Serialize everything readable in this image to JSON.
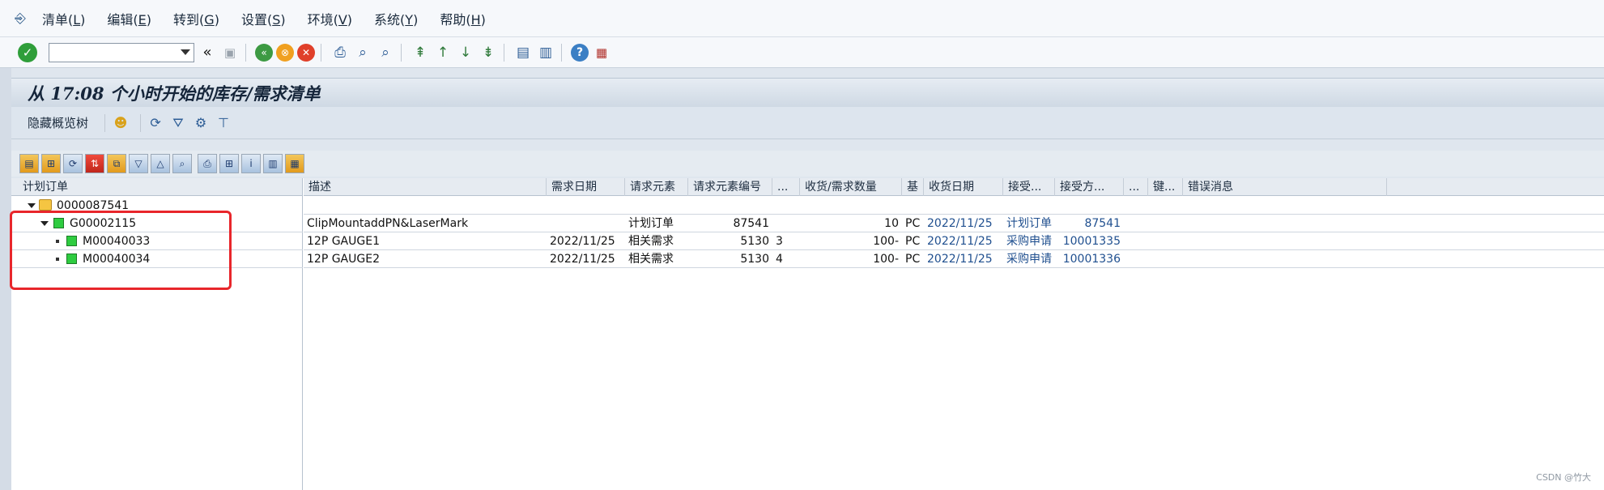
{
  "menu": {
    "items": [
      {
        "label": "清单(",
        "key": "L",
        "tail": ")"
      },
      {
        "label": "编辑(",
        "key": "E",
        "tail": ")"
      },
      {
        "label": "转到(",
        "key": "G",
        "tail": ")"
      },
      {
        "label": "设置(",
        "key": "S",
        "tail": ")"
      },
      {
        "label": "环境(",
        "key": "V",
        "tail": ")"
      },
      {
        "label": "系统(",
        "key": "Y",
        "tail": ")"
      },
      {
        "label": "帮助(",
        "key": "H",
        "tail": ")"
      }
    ]
  },
  "toolbar": {
    "command_value": "",
    "collapse_glyph": "«"
  },
  "title": "从 17:08 个小时开始的库存/需求清单",
  "app_toolbar": {
    "hide_tree_label": "隐藏概览树"
  },
  "tree": {
    "header": "计划订单",
    "nodes": [
      {
        "label": "0000087541"
      },
      {
        "label": "G00002115"
      },
      {
        "label": "M00040033"
      },
      {
        "label": "M00040034"
      }
    ]
  },
  "grid": {
    "columns": [
      "描述",
      "需求日期",
      "请求元素",
      "请求元素编号",
      "...",
      "收货/需求数量",
      "基",
      "收货日期",
      "接受...",
      "接受方...",
      "...",
      "键...",
      "错误消息"
    ],
    "rows": [
      {
        "desc": "ClipMountaddPN&LaserMark",
        "req_date": "",
        "req_elem": "计划订单",
        "req_no": "87541",
        "item": "",
        "qty": "10",
        "unit": "PC",
        "recv_date": "2022/11/25",
        "recv_elem": "计划订单",
        "recv_no": "87541"
      },
      {
        "desc": "12P GAUGE1",
        "req_date": "2022/11/25",
        "req_elem": "相关需求",
        "req_no": "5130",
        "item": "3",
        "qty": "100-",
        "unit": "PC",
        "recv_date": "2022/11/25",
        "recv_elem": "采购申请",
        "recv_no": "10001335"
      },
      {
        "desc": "12P GAUGE2",
        "req_date": "2022/11/25",
        "req_elem": "相关需求",
        "req_no": "5130",
        "item": "4",
        "qty": "100-",
        "unit": "PC",
        "recv_date": "2022/11/25",
        "recv_elem": "采购申请",
        "recv_no": "10001336"
      }
    ]
  },
  "watermark": "CSDN @竹大",
  "colors": {
    "highlight": "#e8262b",
    "status_green": "#2ecc40",
    "link": "#1f4f8f"
  }
}
